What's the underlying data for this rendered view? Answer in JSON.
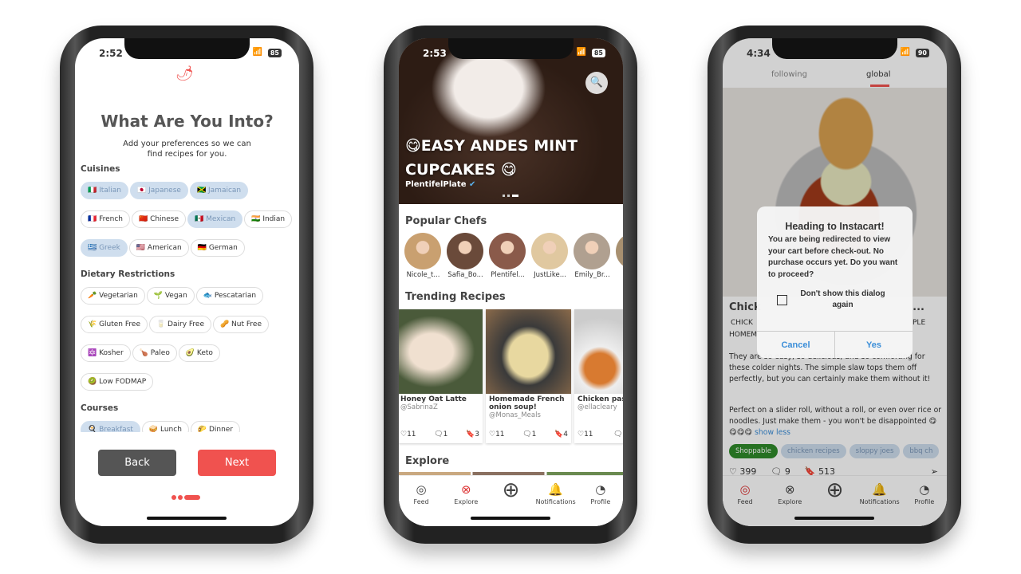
{
  "colors": {
    "accent": "#f0524f",
    "selected_chip": "#cfdeee",
    "shoppable": "#2f8a2a",
    "link": "#3b8ed8"
  },
  "phone1": {
    "time": "2:52",
    "battery": "85",
    "title": "What Are You Into?",
    "subtitle": "Add your preferences so we can find recipes for you.",
    "sections": [
      {
        "label": "Cuisines",
        "chips": [
          {
            "label": "🇮🇹 Italian",
            "selected": true
          },
          {
            "label": "🇯🇵 Japanese",
            "selected": true
          },
          {
            "label": "🇯🇲 Jamaican",
            "selected": true
          },
          {
            "label": "🇫🇷 French",
            "selected": false
          },
          {
            "label": "🇨🇳 Chinese",
            "selected": false
          },
          {
            "label": "🇲🇽 Mexican",
            "selected": true
          },
          {
            "label": "🇮🇳 Indian",
            "selected": false
          },
          {
            "label": "🇬🇷 Greek",
            "selected": true
          },
          {
            "label": "🇺🇸 American",
            "selected": false
          },
          {
            "label": "🇩🇪 German",
            "selected": false
          }
        ]
      },
      {
        "label": "Dietary Restrictions",
        "chips": [
          {
            "label": "🥕 Vegetarian",
            "selected": false
          },
          {
            "label": "🌱 Vegan",
            "selected": false
          },
          {
            "label": "🐟 Pescatarian",
            "selected": false
          },
          {
            "label": "🌾 Gluten Free",
            "selected": false
          },
          {
            "label": "🥛 Dairy Free",
            "selected": false
          },
          {
            "label": "🥜 Nut Free",
            "selected": false
          },
          {
            "label": "🔯 Kosher",
            "selected": false
          },
          {
            "label": "🍗 Paleo",
            "selected": false
          },
          {
            "label": "🥑 Keto",
            "selected": false
          },
          {
            "label": "🥝 Low FODMAP",
            "selected": false
          }
        ]
      },
      {
        "label": "Courses",
        "chips": [
          {
            "label": "🍳 Breakfast",
            "selected": true
          },
          {
            "label": "🥪 Lunch",
            "selected": false
          },
          {
            "label": "🌮 Dinner",
            "selected": false
          },
          {
            "label": "🍰 Dessert",
            "selected": true
          },
          {
            "label": "🥟 Appetizer",
            "selected": false
          },
          {
            "label": "🍹 Drink",
            "selected": false
          },
          {
            "label": "🥨 Snack",
            "selected": false
          },
          {
            "label": "🍟 Side",
            "selected": false
          }
        ]
      }
    ],
    "back": "Back",
    "next": "Next"
  },
  "phone2": {
    "time": "2:53",
    "battery": "85",
    "hero_title": "😋EASY ANDES MINT CUPCAKES 😋",
    "hero_author": "PlentifelPlate",
    "popular_chefs": "Popular Chefs",
    "chefs": [
      "Nicole_t...",
      "Safia_Bo...",
      "Plentifel...",
      "JustLike...",
      "Emily_Br...",
      "this"
    ],
    "trending": "Trending Recipes",
    "recipes": [
      {
        "title": "Honey Oat Latte",
        "author": "@SabrinaZ",
        "likes": "11",
        "comments": "1",
        "saves": "3"
      },
      {
        "title": "Homemade French onion soup!",
        "author": "@Monas_Meals",
        "likes": "11",
        "comments": "1",
        "saves": "4"
      },
      {
        "title": "Chicken pasta",
        "author": "@ellacleary",
        "likes": "11",
        "comments": "0",
        "saves": ""
      }
    ],
    "explore": "Explore",
    "nav": [
      "Feed",
      "Explore",
      "",
      "Notifications",
      "Profile"
    ]
  },
  "phone3": {
    "time": "4:34",
    "battery": "90",
    "tabs": [
      "following",
      "global"
    ],
    "title_fragment": "Chick",
    "title_end": "...",
    "desc_fragments": [
      "CHICK",
      "PLE",
      "HOMEM"
    ],
    "body1": "They are so easy, so delicious, and so comforting for these colder nights. The simple slaw tops them off perfectly, but you can certainly make them without it!",
    "body2": "Perfect on a slider roll, without a roll, or even over rice or noodles. Just make them - you won't be disappointed 😋😋😋😋",
    "show_less": "show less",
    "tags": [
      "Shoppable",
      "chicken recipes",
      "sloppy joes",
      "bbq ch"
    ],
    "likes": "399",
    "comments": "9",
    "saves": "513",
    "dialog": {
      "title": "Heading to Instacart!",
      "message": "You are being redirected to view your cart before check-out. No purchase occurs yet. Do you want to proceed?",
      "checkbox": "Don't show this dialog again",
      "cancel": "Cancel",
      "yes": "Yes"
    },
    "nav": [
      "Feed",
      "Explore",
      "",
      "Notifications",
      "Profile"
    ]
  }
}
